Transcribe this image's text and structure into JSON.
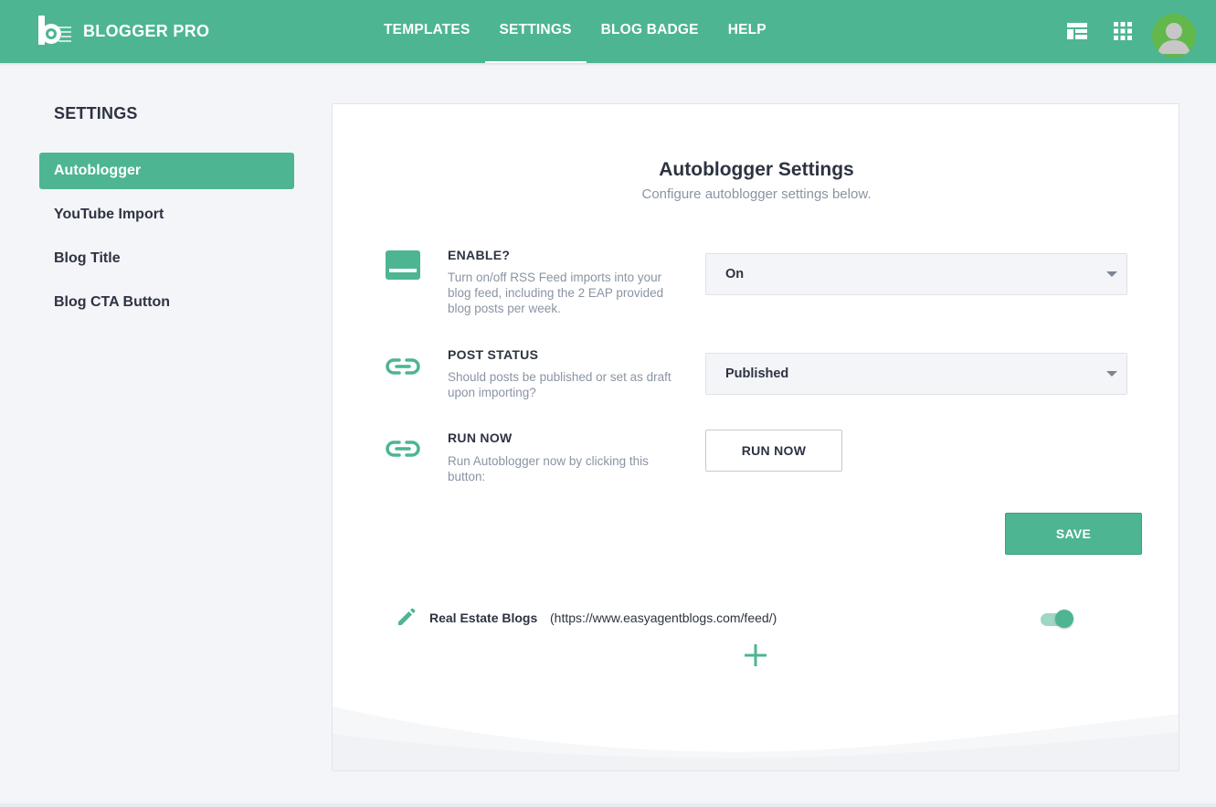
{
  "app": {
    "name": "BLOGGER PRO",
    "logo_icon": "blogger-pro-logo-icon"
  },
  "nav": {
    "items": [
      {
        "label": "TEMPLATES",
        "active": false
      },
      {
        "label": "SETTINGS",
        "active": true
      },
      {
        "label": "BLOG BADGE",
        "active": false
      },
      {
        "label": "HELP",
        "active": false
      }
    ],
    "icons": [
      "dashboard-layout-icon",
      "apps-grid-icon",
      "user-avatar"
    ]
  },
  "sidebar": {
    "title": "SETTINGS",
    "items": [
      {
        "label": "Autoblogger",
        "active": true
      },
      {
        "label": "YouTube Import",
        "active": false
      },
      {
        "label": "Blog Title",
        "active": false
      },
      {
        "label": "Blog CTA Button",
        "active": false
      }
    ]
  },
  "main": {
    "title": "Autoblogger Settings",
    "subtitle": "Configure autoblogger settings below.",
    "rows": [
      {
        "icon": "toggle-panel-icon",
        "label": "ENABLE?",
        "description": "Turn on/off RSS Feed imports into your blog feed, including the 2 EAP provided blog posts per week.",
        "control": "select",
        "value": "On"
      },
      {
        "icon": "link-icon",
        "label": "POST STATUS",
        "description": "Should posts be published or set as draft upon importing?",
        "control": "select",
        "value": "Published"
      },
      {
        "icon": "link-icon",
        "label": "RUN NOW",
        "description": "Run Autoblogger now by clicking this button:",
        "control": "button",
        "value": "RUN NOW"
      }
    ],
    "save_label": "SAVE",
    "feeds": [
      {
        "name": "Real Estate Blogs",
        "url": "(https://www.easyagentblogs.com/feed/)",
        "enabled": true
      }
    ],
    "add_icon": "plus-icon"
  },
  "colors": {
    "brand": "#4db592",
    "text": "#2d3341",
    "muted": "#8a94a3",
    "background": "#f4f5f8"
  }
}
